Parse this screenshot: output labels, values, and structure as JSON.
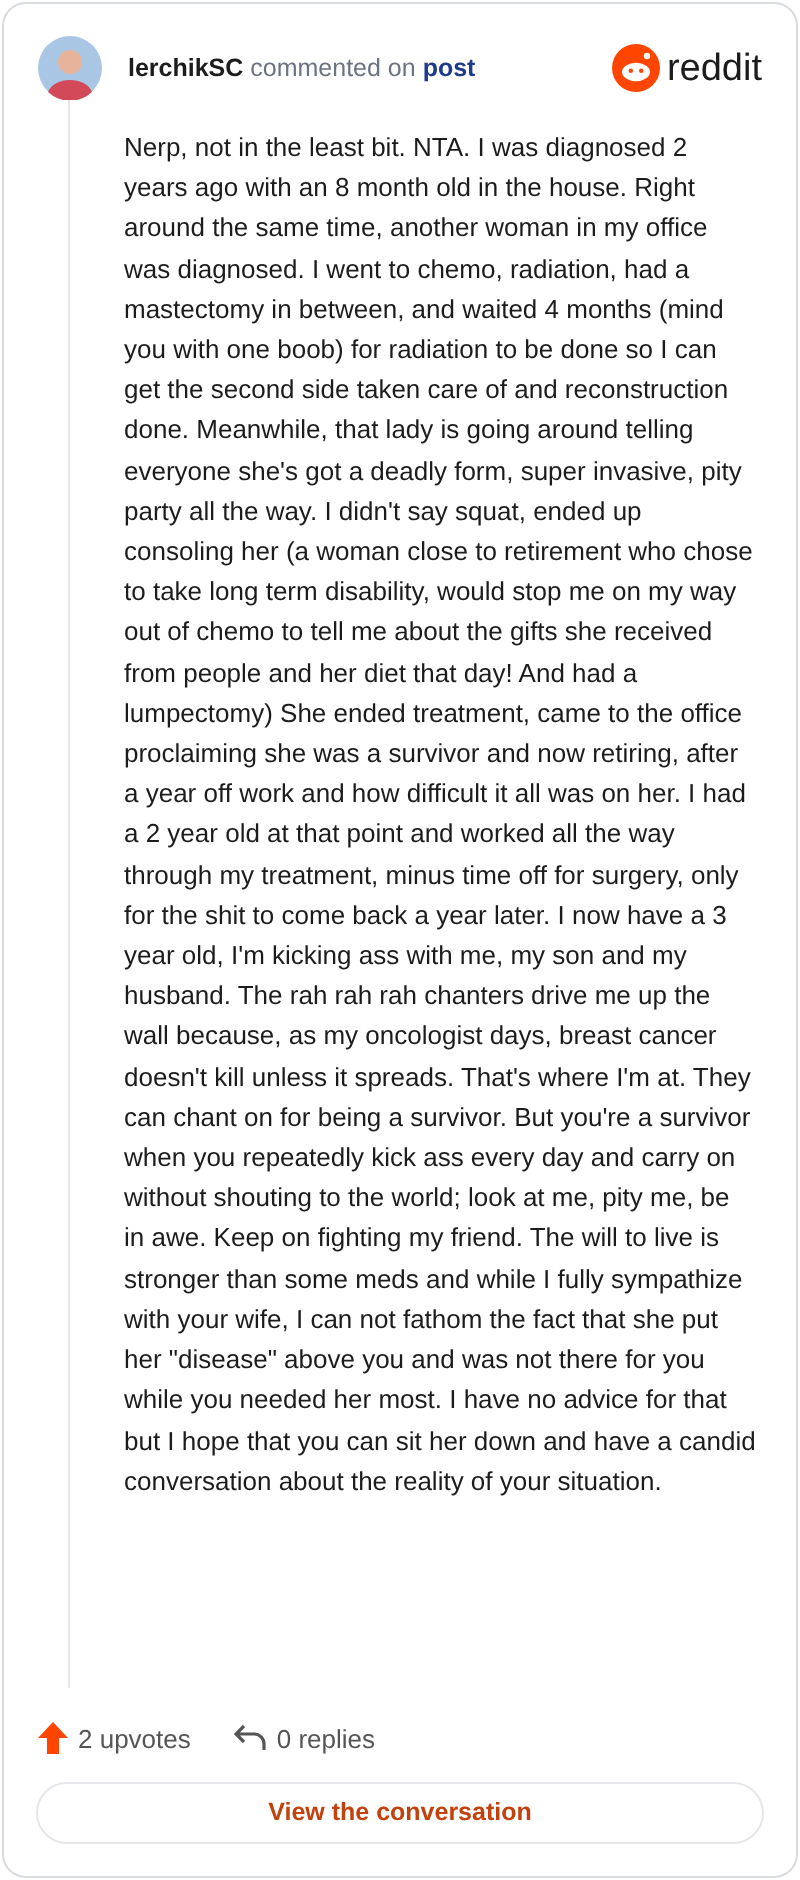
{
  "header": {
    "author": "lerchikSC",
    "action": "commented on",
    "link": "post",
    "brand": "reddit"
  },
  "comment": {
    "body": "Nerp, not in the least bit. NTA. I was diagnosed 2 years ago with an 8 month old in the house. Right around the same time, another woman in my office was diagnosed. I went to chemo, radiation, had a mastectomy in between, and waited 4 months (mind you with one boob) for radiation to be done so I can get the second side taken care of and reconstruction done. Meanwhile, that lady is going around telling everyone she's got a deadly form, super invasive, pity party all the way. I didn't say squat, ended up consoling her (a woman close to retirement who chose to take long term disability, would stop me on my way out of chemo to tell me about the gifts she received from people and her diet that day! And had a lumpectomy) She ended treatment, came to the office proclaiming she was a survivor and now retiring, after a year off work and how difficult it all was on her. I had a 2 year old at that point and worked all the way through my treatment, minus time off for surgery, only for the shit to come back a year later. I now have a 3 year old, I'm kicking ass with me, my son and my husband. The rah rah rah chanters drive me up the wall because, as my oncologist days, breast cancer doesn't kill unless it spreads. That's where I'm at. They can chant on for being a survivor. But you're a survivor when you repeatedly kick ass every day and carry on without shouting to the world; look at me, pity me, be in awe. Keep on fighting my friend. The will to live is stronger than some meds and while I fully sympathize with your wife, I can not fathom the fact that she put her \"disease\" above you and was not there for you while you needed her most. I have no advice for that but I hope that you can sit her down and have a candid conversation about the reality of your situation."
  },
  "footer": {
    "upvotes": "2 upvotes",
    "replies": "0 replies",
    "button": "View the conversation"
  }
}
